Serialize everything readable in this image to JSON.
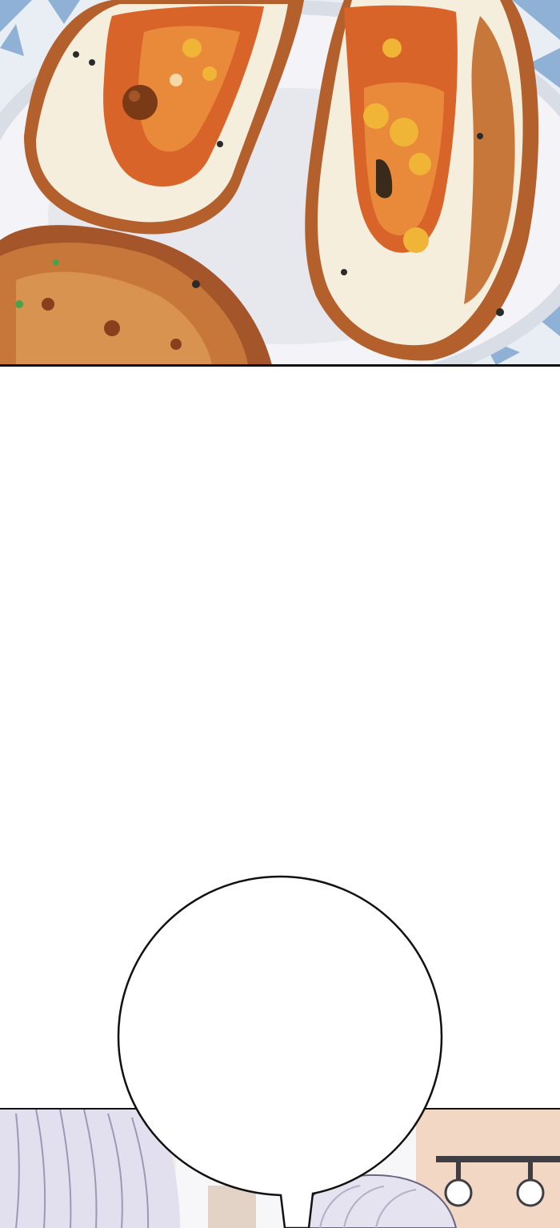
{
  "comic": {
    "panels": [
      {
        "scene": "food-closeup"
      },
      {
        "scene": "blank-gutter"
      },
      {
        "scene": "character-background"
      }
    ],
    "speech_bubble": {
      "text": ""
    },
    "colors": {
      "panel_border": "#111111",
      "bubble_fill": "#ffffff",
      "crust": "#c8773a",
      "crust_dark": "#8a3f1c",
      "filling": "#d9642a",
      "filling_yellow": "#f0b437",
      "bread": "#f5eedc",
      "plate": "#f4f4f8",
      "tablecloth": "#8fb1d6"
    }
  }
}
